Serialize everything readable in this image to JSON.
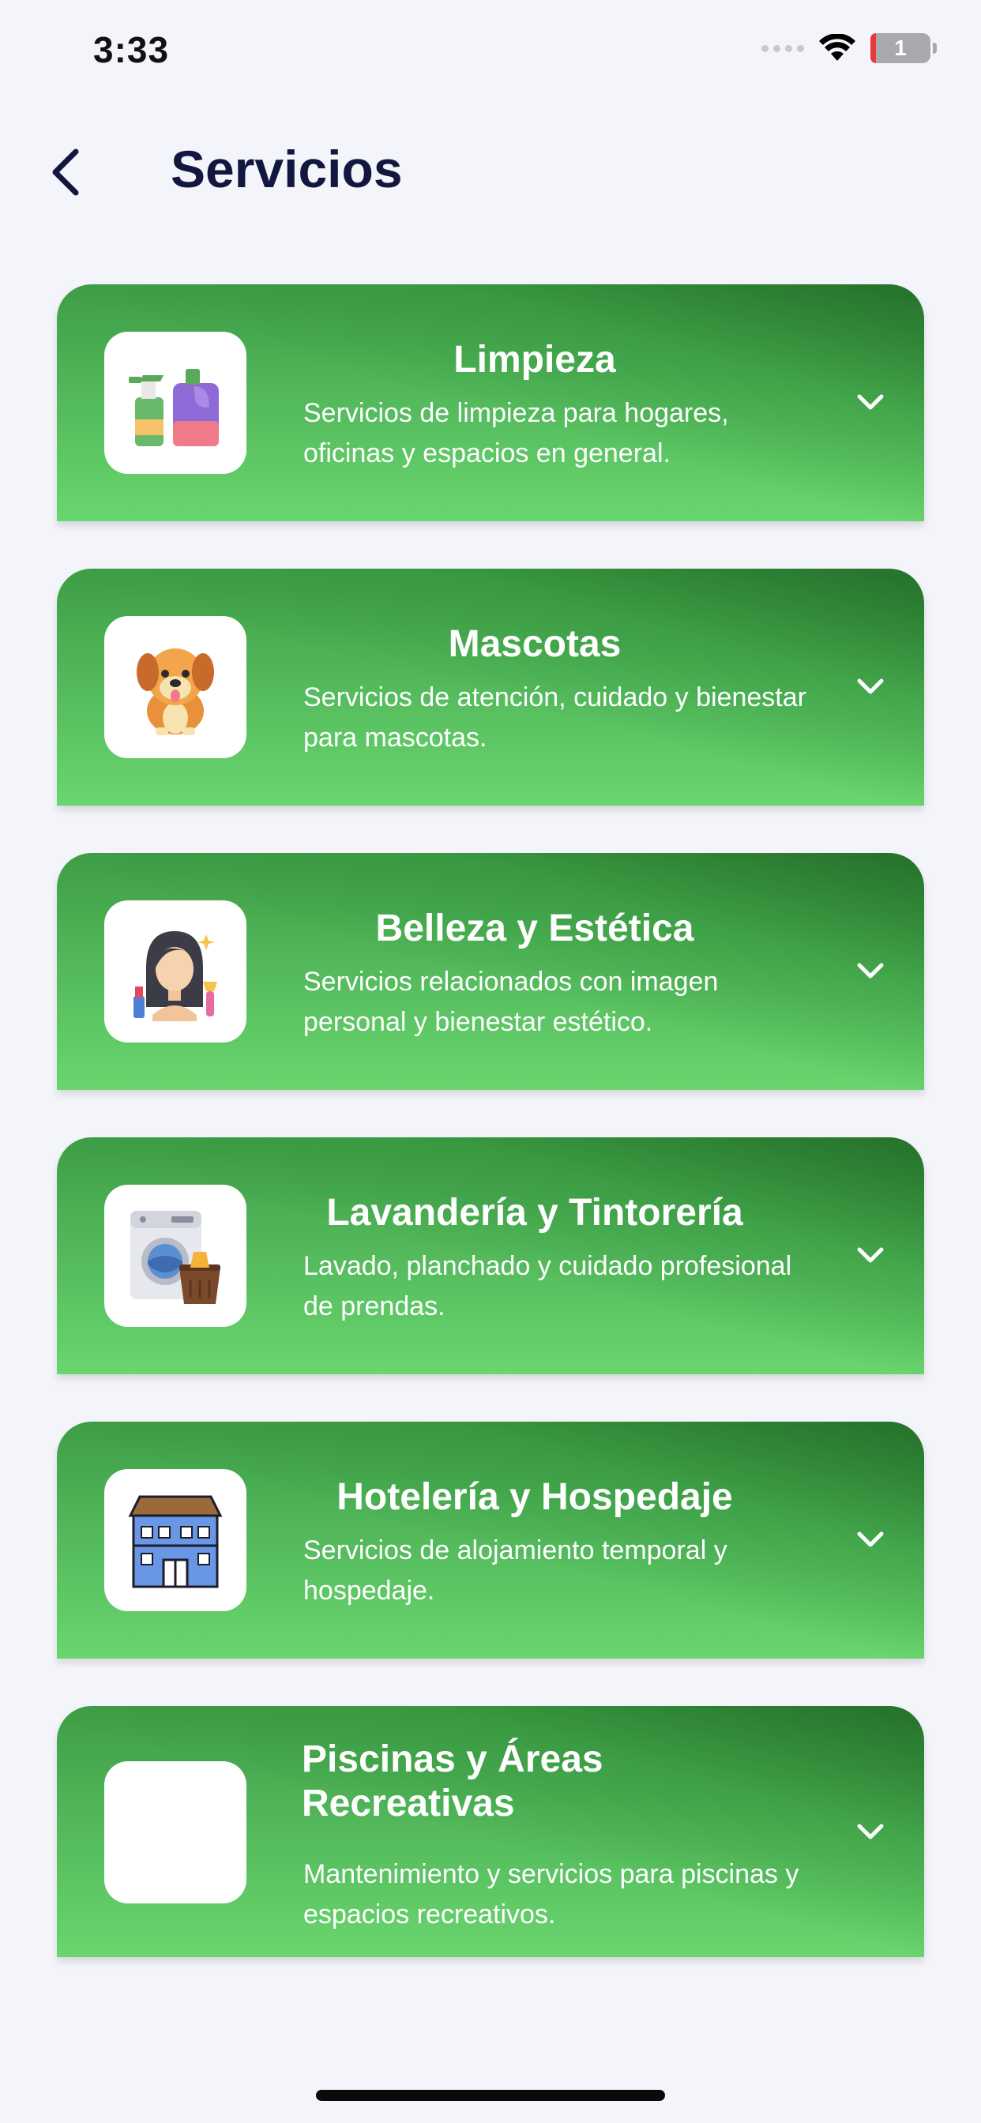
{
  "status_bar": {
    "time": "3:33",
    "battery": "1"
  },
  "header": {
    "title": "Servicios"
  },
  "services": [
    {
      "title": "Limpieza",
      "description": "Servicios de limpieza para hogares, oficinas y espacios en general.",
      "icon": "cleaning-products-icon"
    },
    {
      "title": "Mascotas",
      "description": "Servicios de atención, cuidado y bienestar para mascotas.",
      "icon": "dog-icon"
    },
    {
      "title": "Belleza y Estética",
      "description": "Servicios relacionados con imagen personal y bienestar estético.",
      "icon": "beauty-woman-icon"
    },
    {
      "title": "Lavandería y Tintorería",
      "description": "Lavado, planchado y cuidado profesional de prendas.",
      "icon": "washing-machine-icon"
    },
    {
      "title": "Hotelería y Hospedaje",
      "description": "Servicios de alojamiento temporal y hospedaje.",
      "icon": "hotel-building-icon"
    },
    {
      "title": "Piscinas y Áreas Recreativas",
      "description": "Mantenimiento y servicios para piscinas y espacios recreativos.",
      "icon": "blank-icon"
    }
  ],
  "colors": {
    "card_top": "#2f7d33",
    "card_bottom": "#6ad66f",
    "title": "#12173f",
    "background": "#f4f5fa"
  }
}
